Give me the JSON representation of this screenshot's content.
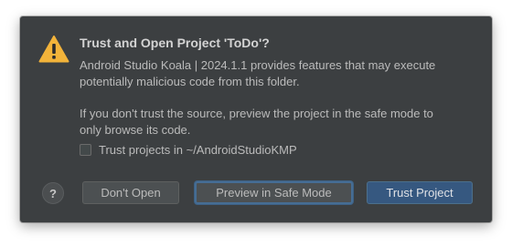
{
  "dialog": {
    "title": "Trust and Open Project 'ToDo'?",
    "message": "Android Studio Koala | 2024.1.1 provides features that may execute\npotentially malicious code from this folder.",
    "hint": "If you don't trust the source, preview the project in the safe mode to\nonly browse its code.",
    "checkbox_label": "Trust projects in ~/AndroidStudioKMP",
    "checkbox_checked": false,
    "icon": "warning-icon"
  },
  "buttons": {
    "help_label": "?",
    "dont_open_label": "Don't Open",
    "preview_label": "Preview in Safe Mode",
    "trust_label": "Trust Project"
  },
  "colors": {
    "dialog_bg": "#3c3f41",
    "warning_yellow": "#f2b33a",
    "primary_button": "#365880",
    "focus_ring": "#466d94"
  }
}
